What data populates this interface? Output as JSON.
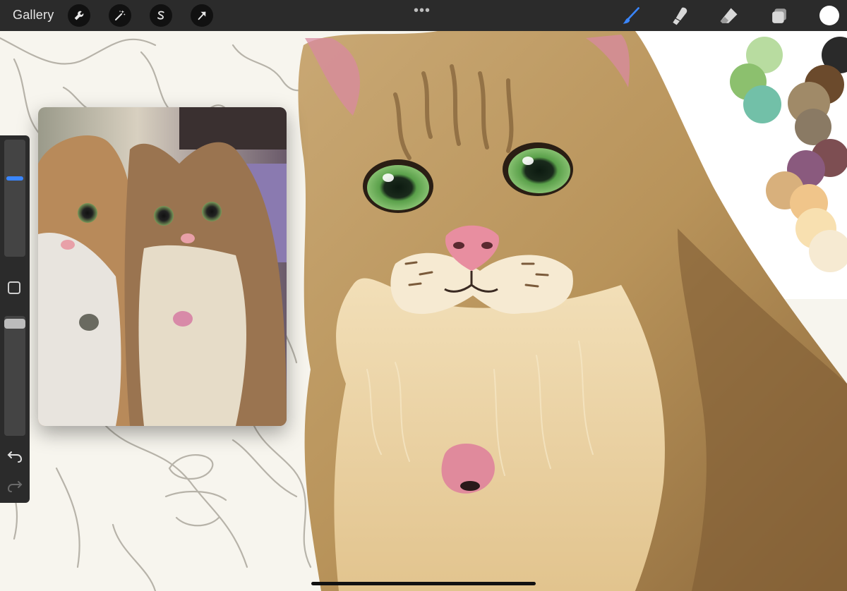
{
  "topbar": {
    "gallery_label": "Gallery",
    "left_tools": [
      "wrench-icon",
      "magic-wand-icon",
      "selection-s-icon",
      "arrow-transform-icon"
    ],
    "more_label": "•••",
    "right_tools": [
      "brush-icon",
      "smudge-icon",
      "eraser-icon",
      "layers-icon"
    ],
    "current_color": "#ffffff",
    "active_tool_color": "#3a86ff"
  },
  "sidebar": {
    "brush_size_level": 0.2,
    "opacity_level": 0.0,
    "undo_icon": "undo-icon",
    "redo_icon": "redo-icon"
  },
  "palette": [
    "#b8dca0",
    "#8cc06e",
    "#72c0a8",
    "#2a2a2a",
    "#6b4a2c",
    "#a08a68",
    "#8a7a64",
    "#7d4e52",
    "#8a5a7e",
    "#d8b07c",
    "#f0c58a",
    "#f8e0b0",
    "#f6ead2"
  ]
}
